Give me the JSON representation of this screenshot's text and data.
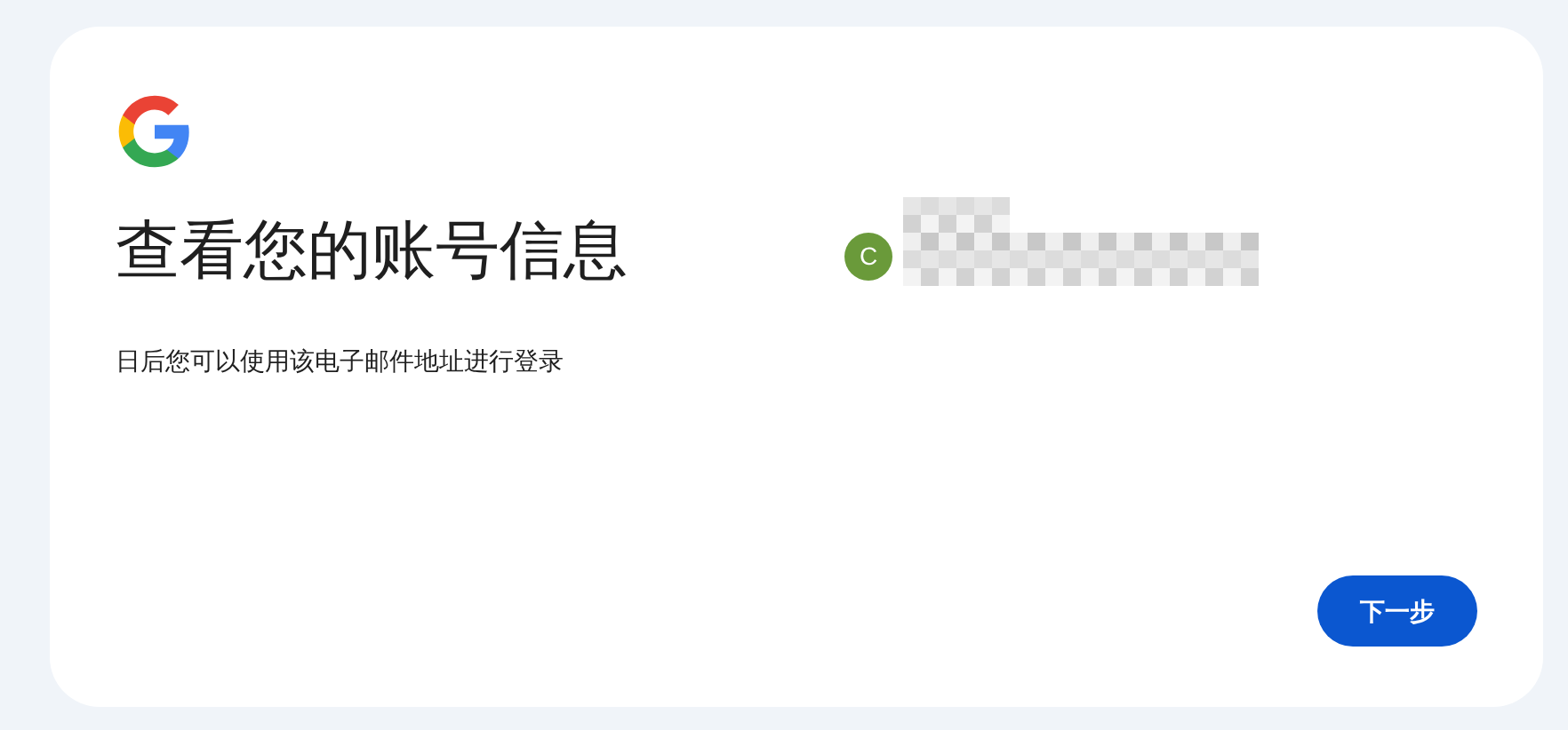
{
  "card": {
    "title": "查看您的账号信息",
    "subtitle": "日后您可以使用该电子邮件地址进行登录"
  },
  "account": {
    "avatar_letter": "C"
  },
  "next_button": "下一步"
}
